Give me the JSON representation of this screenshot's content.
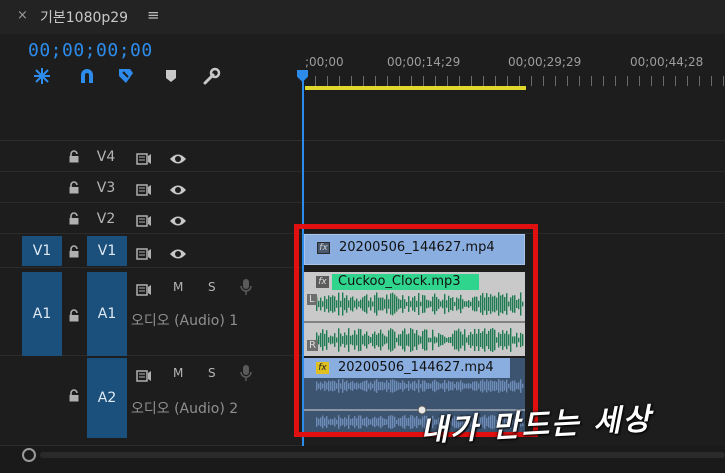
{
  "sequence": {
    "close_icon": "×",
    "name": "기본1080p29",
    "menu_icon": "≡"
  },
  "timecode": "00;00;00;00",
  "toolbar": [
    "snap-icon",
    "linked-selection-icon",
    "add-marker-icon",
    "marker-icon",
    "wrench-icon"
  ],
  "ruler": {
    "labels": [
      ";00;00",
      "00;00;14;29",
      "00;00;29;29",
      "00;00;44;28"
    ]
  },
  "video_tracks": [
    {
      "name": "V4",
      "source_patch": ""
    },
    {
      "name": "V3",
      "source_patch": ""
    },
    {
      "name": "V2",
      "source_patch": ""
    },
    {
      "name": "V1",
      "source_patch": "V1"
    }
  ],
  "audio_tracks": [
    {
      "name": "A1",
      "source_patch": "A1",
      "mute": "M",
      "solo": "S",
      "label": "오디오 (Audio) 1"
    },
    {
      "name": "A2",
      "source_patch": "",
      "mute": "M",
      "solo": "S",
      "label": "오디오 (Audio) 2"
    }
  ],
  "clips": {
    "v1": {
      "name": "20200506_144627.mp4",
      "fx": "fx",
      "color": "#8aaee0"
    },
    "a1": {
      "name": "Cuckoo_Clock.mp3",
      "fx": "fx",
      "color": "#2fd58c",
      "channel_left": "L",
      "channel_right": "R"
    },
    "a2": {
      "name": "20200506_144627.mp4",
      "fx": "fx",
      "color": "#8aaee0"
    }
  },
  "watermark": "내가 만드는 세상",
  "colors": {
    "accent": "#2d8ceb",
    "work_area": "#e0d82c",
    "highlight_frame": "#e01010"
  }
}
